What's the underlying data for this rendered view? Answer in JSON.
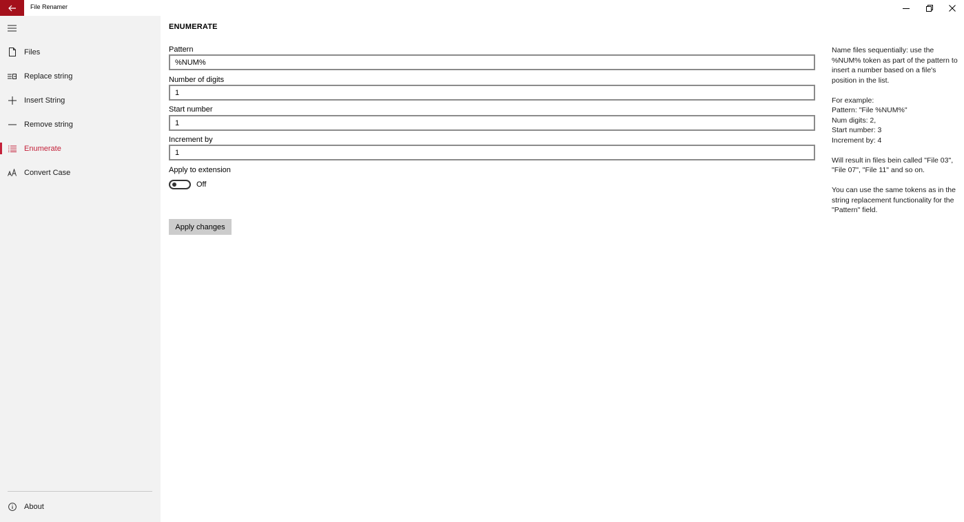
{
  "window": {
    "title": "File Renamer"
  },
  "sidebar": {
    "items": [
      {
        "label": "Files",
        "icon": "file-icon"
      },
      {
        "label": "Replace string",
        "icon": "replace-icon"
      },
      {
        "label": "Insert String",
        "icon": "plus-icon"
      },
      {
        "label": "Remove string",
        "icon": "minus-icon"
      },
      {
        "label": "Enumerate",
        "icon": "list-icon",
        "active": true
      },
      {
        "label": "Convert Case",
        "icon": "font-case-icon"
      }
    ],
    "footer": {
      "label": "About",
      "icon": "info-icon"
    }
  },
  "main": {
    "title": "ENUMERATE",
    "pattern": {
      "label": "Pattern",
      "value": "%NUM%"
    },
    "digits": {
      "label": "Number of digits",
      "value": "1"
    },
    "start": {
      "label": "Start number",
      "value": "1"
    },
    "increment": {
      "label": "Increment by",
      "value": "1"
    },
    "extension": {
      "label": "Apply to extension",
      "state": "Off",
      "on": false
    },
    "apply_label": "Apply changes"
  },
  "help": {
    "intro": "Name files sequentially: use the %NUM% token as part of the pattern to insert a number based on a file's position in the list.",
    "example_heading": "For example:",
    "example_lines": [
      "Pattern: \"File %NUM%\"",
      "Num digits: 2,",
      "Start number: 3",
      "Increment by: 4"
    ],
    "result": "Will result in files bein called \"File 03\", \"File 07\", \"File 11\" and so on.",
    "note": "You can use the same tokens as in the string replacement functionality for the \"Pattern\" field."
  },
  "colors": {
    "accent": "#c4213a",
    "back_button": "#a4101b",
    "sidebar_bg": "#f2f2f2",
    "button_bg": "#cccccc"
  }
}
